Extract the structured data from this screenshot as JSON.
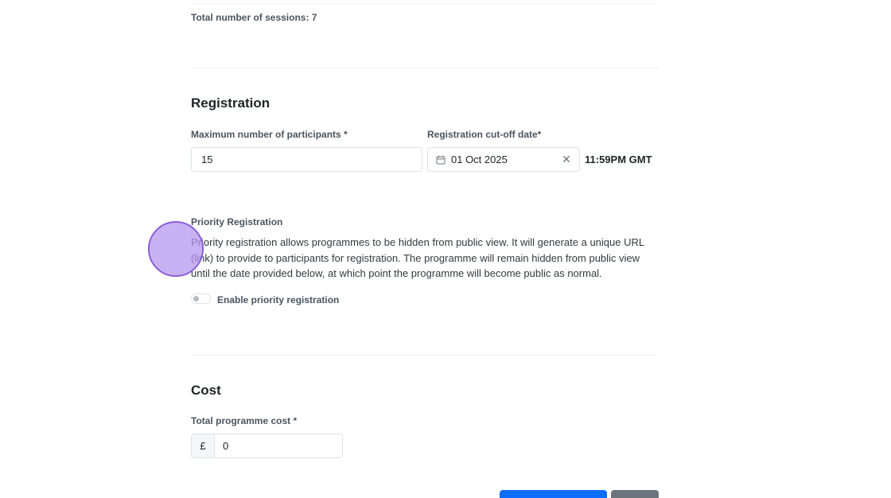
{
  "schedule": {
    "sessions_text": "Total number of sessions: 7"
  },
  "registration": {
    "title": "Registration",
    "max_participants_label": "Maximum number of participants *",
    "max_participants_value": "15",
    "cutoff_label": "Registration cut-off date*",
    "cutoff_date": "01 Oct 2025",
    "cutoff_time": "11:59PM GMT",
    "calendar_icon": "calendar-icon",
    "clear_icon_glyph": "✕"
  },
  "priority": {
    "label": "Priority Registration",
    "description": "Priority registration allows programmes to be hidden from public view. It will generate a unique URL (link) to provide to participants for registration. The programme will remain hidden from public view until the date provided below, at which point the programme will become public as normal.",
    "toggle_label": "Enable priority registration",
    "toggle_enabled": false
  },
  "cost": {
    "title": "Cost",
    "total_label": "Total programme cost *",
    "currency_symbol": "£",
    "total_value": "0"
  },
  "colors": {
    "primary": "#0d6efd",
    "secondary": "#6c757d",
    "cursor_fill": "#b494ee",
    "cursor_border": "#8a5fd8"
  }
}
